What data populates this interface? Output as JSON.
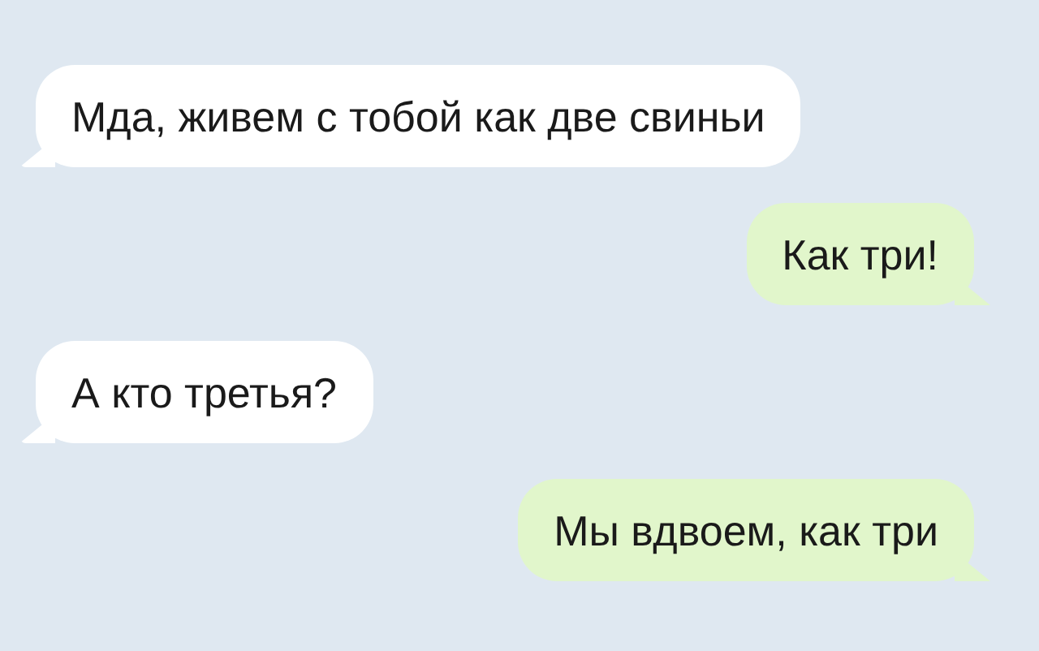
{
  "messages": [
    {
      "text": "Мда, живем с тобой как две свиньи",
      "kind": "incoming"
    },
    {
      "text": "Как три!",
      "kind": "outgoing"
    },
    {
      "text": "А кто третья?",
      "kind": "incoming"
    },
    {
      "text": "Мы вдвоем, как три",
      "kind": "outgoing"
    }
  ]
}
